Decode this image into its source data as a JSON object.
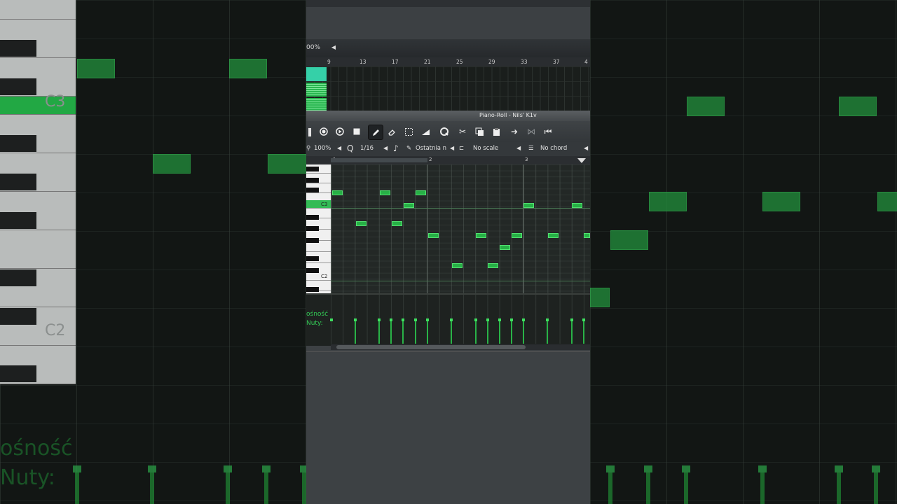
{
  "song_editor": {
    "zoom": "00%",
    "timeline": [
      "9",
      "13",
      "17",
      "21",
      "25",
      "29",
      "33",
      "37",
      "4"
    ]
  },
  "piano_roll": {
    "title": "Piano-Roll - Nils' K1v",
    "zoom": "100%",
    "quantize": "1/16",
    "note_length": "Ostatnia n",
    "scale": "No scale",
    "chord": "No chord",
    "timeline": [
      "1",
      "2",
      "3"
    ],
    "key_labels": {
      "c3": "C3",
      "c2": "C2"
    },
    "velocity_label_line1": "ośność",
    "velocity_label_line2": "Nuty:"
  },
  "background_zoom": {
    "key_labels": [
      "C3",
      "C2"
    ],
    "velocity_label_line1": "ośność",
    "velocity_label_line2": "Nuty:"
  },
  "colors": {
    "note": "#27b046",
    "accent": "#33bb55",
    "pattern": "#35d0a8"
  },
  "icons": {
    "toolbar": [
      "pause-icon",
      "record-icon",
      "play-icon",
      "stop-icon",
      "pencil-icon",
      "eraser-icon",
      "select-icon",
      "detune-icon",
      "quantize-icon",
      "cut-icon",
      "copy-icon",
      "paste-icon",
      "forward-icon",
      "glue-icon",
      "rewind-icon"
    ]
  }
}
